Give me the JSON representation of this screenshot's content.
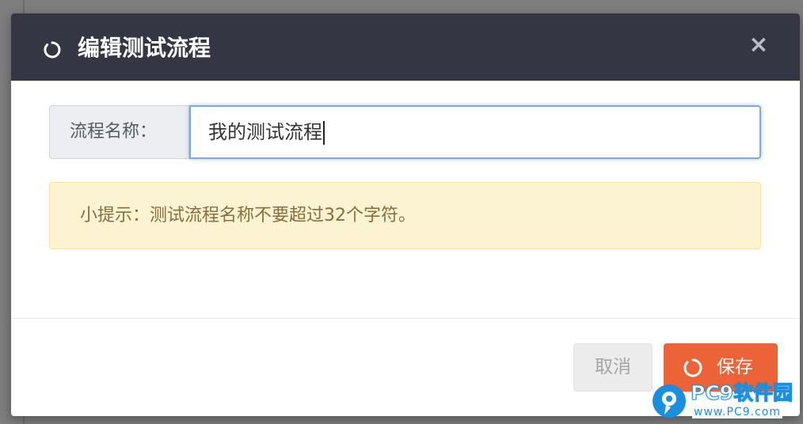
{
  "dialog": {
    "title": "编辑测试流程",
    "header_icon": "spinner-ring-icon",
    "close_glyph": "×",
    "close_icon": "close-icon"
  },
  "form": {
    "name_label": "流程名称：",
    "name_value": "我的测试流程"
  },
  "hint": {
    "text": "小提示：测试流程名称不要超过32个字符。"
  },
  "footer": {
    "cancel_label": "取消",
    "save_label": "保存",
    "save_icon": "spinner-ring-icon"
  },
  "watermark": {
    "brand": "PC9软件园",
    "url": "www.PC9.com"
  },
  "colors": {
    "header_bg": "#343743",
    "save_button": "#ec6338",
    "alert_bg": "#fcf3d2",
    "alert_text": "#8a6d3b",
    "input_focus": "#7ba9e6",
    "watermark_blue": "#1a8fe0"
  }
}
